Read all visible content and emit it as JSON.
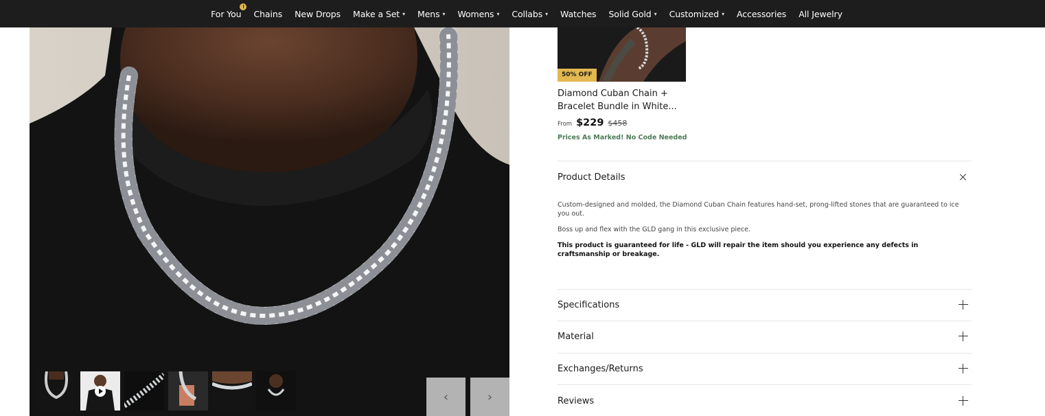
{
  "nav": {
    "items": [
      {
        "label": "For You",
        "badge": "!",
        "caret": false
      },
      {
        "label": "Chains",
        "caret": false
      },
      {
        "label": "New Drops",
        "caret": false
      },
      {
        "label": "Make a Set",
        "caret": true
      },
      {
        "label": "Mens",
        "caret": true
      },
      {
        "label": "Womens",
        "caret": true
      },
      {
        "label": "Collabs",
        "caret": true
      },
      {
        "label": "Watches",
        "caret": false
      },
      {
        "label": "Solid Gold",
        "caret": true
      },
      {
        "label": "Customized",
        "caret": true
      },
      {
        "label": "Accessories",
        "caret": false
      },
      {
        "label": "All Jewelry",
        "caret": false
      }
    ],
    "caret_glyph": "▾"
  },
  "gallery": {
    "thumbnails": [
      "chain-front",
      "model-video",
      "chain-closeup",
      "chain-on-card",
      "chain-on-neck",
      "model-portrait"
    ],
    "prev_glyph": "‹",
    "next_glyph": "›"
  },
  "bundle": {
    "badge": "50% OFF",
    "title": "Diamond Cuban Chain + Bracelet Bundle in White...",
    "price_from": "From",
    "price": "$229",
    "old_price": "$458",
    "promo": "Prices As Marked! No Code Needed"
  },
  "details": {
    "title": "Product Details",
    "paragraphs": [
      "Custom-designed and molded, the Diamond Cuban Chain features hand-set, prong-lifted stones that are guaranteed to ice you out.",
      "Boss up and flex with the GLD gang in this exclusive piece."
    ],
    "guarantee": "This product is guaranteed for life - GLD will repair the item should you experience any defects in craftsmanship or breakage."
  },
  "accordion": [
    {
      "label": "Specifications"
    },
    {
      "label": "Material"
    },
    {
      "label": "Exchanges/Returns"
    },
    {
      "label": "Reviews"
    }
  ],
  "colors": {
    "nav_bg": "#1d1d1d",
    "accent_gold": "#e2b84f",
    "promo_green": "#4c7a58"
  }
}
